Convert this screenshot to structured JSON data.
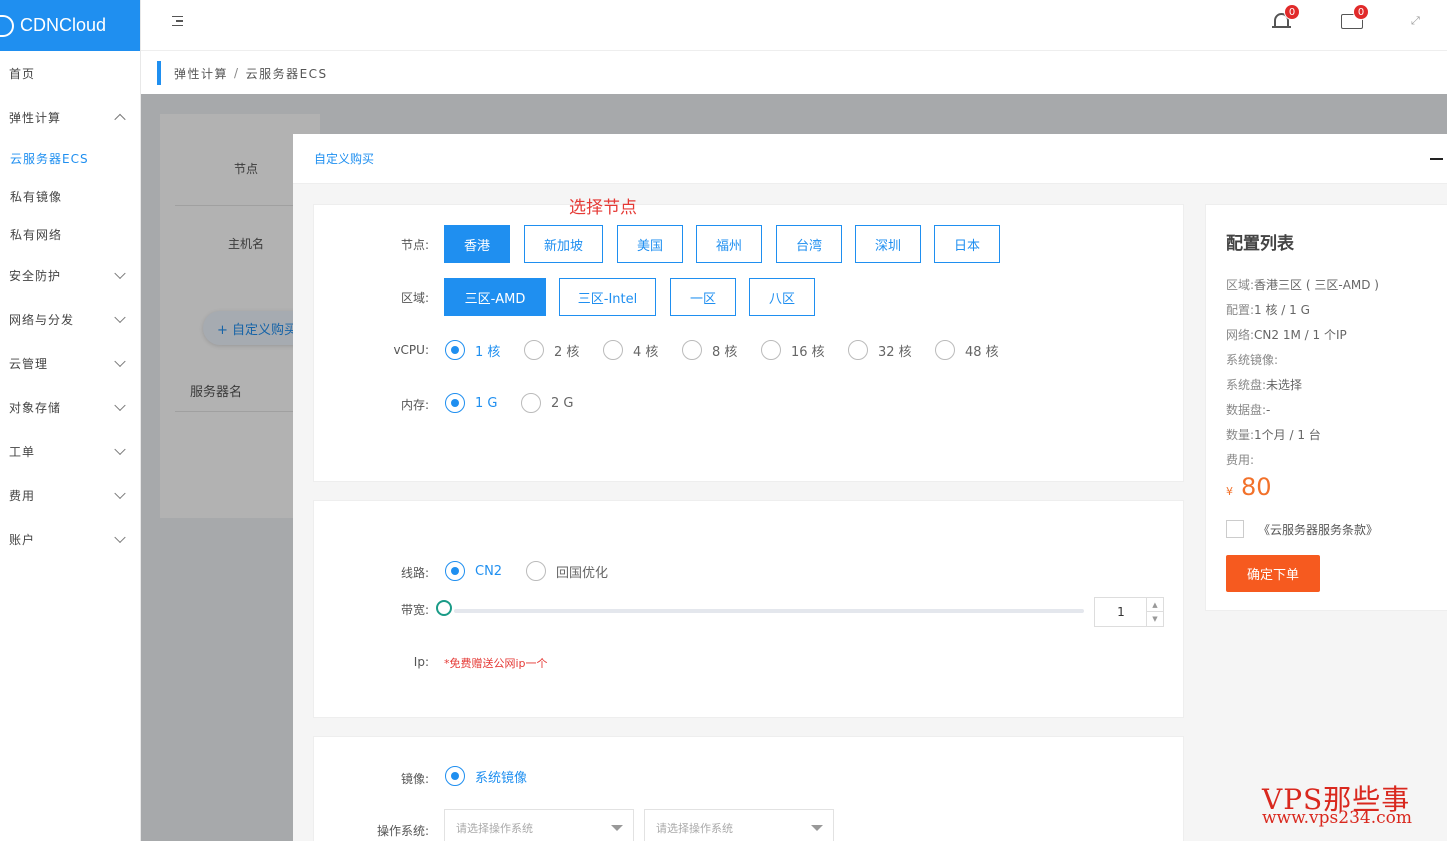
{
  "app": {
    "brand": "CDNCloud"
  },
  "sidebar": {
    "items": [
      {
        "label": "首页"
      },
      {
        "label": "弹性计算"
      },
      {
        "label": "云服务器ECS"
      },
      {
        "label": "私有镜像"
      },
      {
        "label": "私有网络"
      },
      {
        "label": "安全防护"
      },
      {
        "label": "网络与分发"
      },
      {
        "label": "云管理"
      },
      {
        "label": "对象存储"
      },
      {
        "label": "工单"
      },
      {
        "label": "费用"
      },
      {
        "label": "账户"
      }
    ]
  },
  "topbar": {
    "notifications_count": "0",
    "messages_count": "0"
  },
  "breadcrumb": {
    "parent": "弹性计算",
    "separator": "/",
    "current": "云服务器ECS"
  },
  "background": {
    "node_label": "节点",
    "hostname_label": "主机名",
    "custom_buy_button": "+ 自定义购买",
    "server_name_header": "服务器名"
  },
  "dialog": {
    "title": "自定义购买",
    "annotation": "选择节点",
    "node": {
      "label": "节点:",
      "options": [
        "香港",
        "新加坡",
        "美国",
        "福州",
        "台湾",
        "深圳",
        "日本"
      ],
      "selected": "香港"
    },
    "region": {
      "label": "区域:",
      "options": [
        "三区-AMD",
        "三区-Intel",
        "一区",
        "八区"
      ],
      "selected": "三区-AMD"
    },
    "vcpu": {
      "label": "vCPU:",
      "options": [
        "1 核",
        "2 核",
        "4 核",
        "8 核",
        "16 核",
        "32 核",
        "48 核"
      ],
      "selected": "1 核"
    },
    "memory": {
      "label": "内存:",
      "options": [
        "1 G",
        "2 G"
      ],
      "selected": "1 G"
    },
    "line": {
      "label": "线路:",
      "options": [
        "CN2",
        "回国优化"
      ],
      "selected": "CN2"
    },
    "bandwidth": {
      "label": "带宽:",
      "value": "1",
      "slider_level": 0
    },
    "ip": {
      "label": "Ip:",
      "note": "*免费赠送公网ip一个"
    },
    "image": {
      "label": "镜像:",
      "option": "系统镜像"
    },
    "os": {
      "label": "操作系统:",
      "placeholder1": "请选择操作系统",
      "placeholder2": "请选择操作系统"
    }
  },
  "summary": {
    "title": "配置列表",
    "lines": [
      {
        "key": "区域:",
        "value": "香港三区 ( 三区-AMD )"
      },
      {
        "key": "配置:",
        "value": "1 核 / 1 G"
      },
      {
        "key": "网络:",
        "value": "CN2 1M / 1 个IP"
      },
      {
        "key": "系统镜像:",
        "value": ""
      },
      {
        "key": "系统盘:",
        "value": "未选择"
      },
      {
        "key": "数据盘:",
        "value": "-"
      },
      {
        "key": "数量:",
        "value": "1个月 / 1 台"
      },
      {
        "key": "费用:",
        "value": ""
      }
    ],
    "currency": "¥",
    "price": "80",
    "terms": "《云服务器服务条款》",
    "order_button": "确定下单"
  },
  "watermark": {
    "line1": "VPS那些事",
    "line2": "www.vps234.com"
  }
}
